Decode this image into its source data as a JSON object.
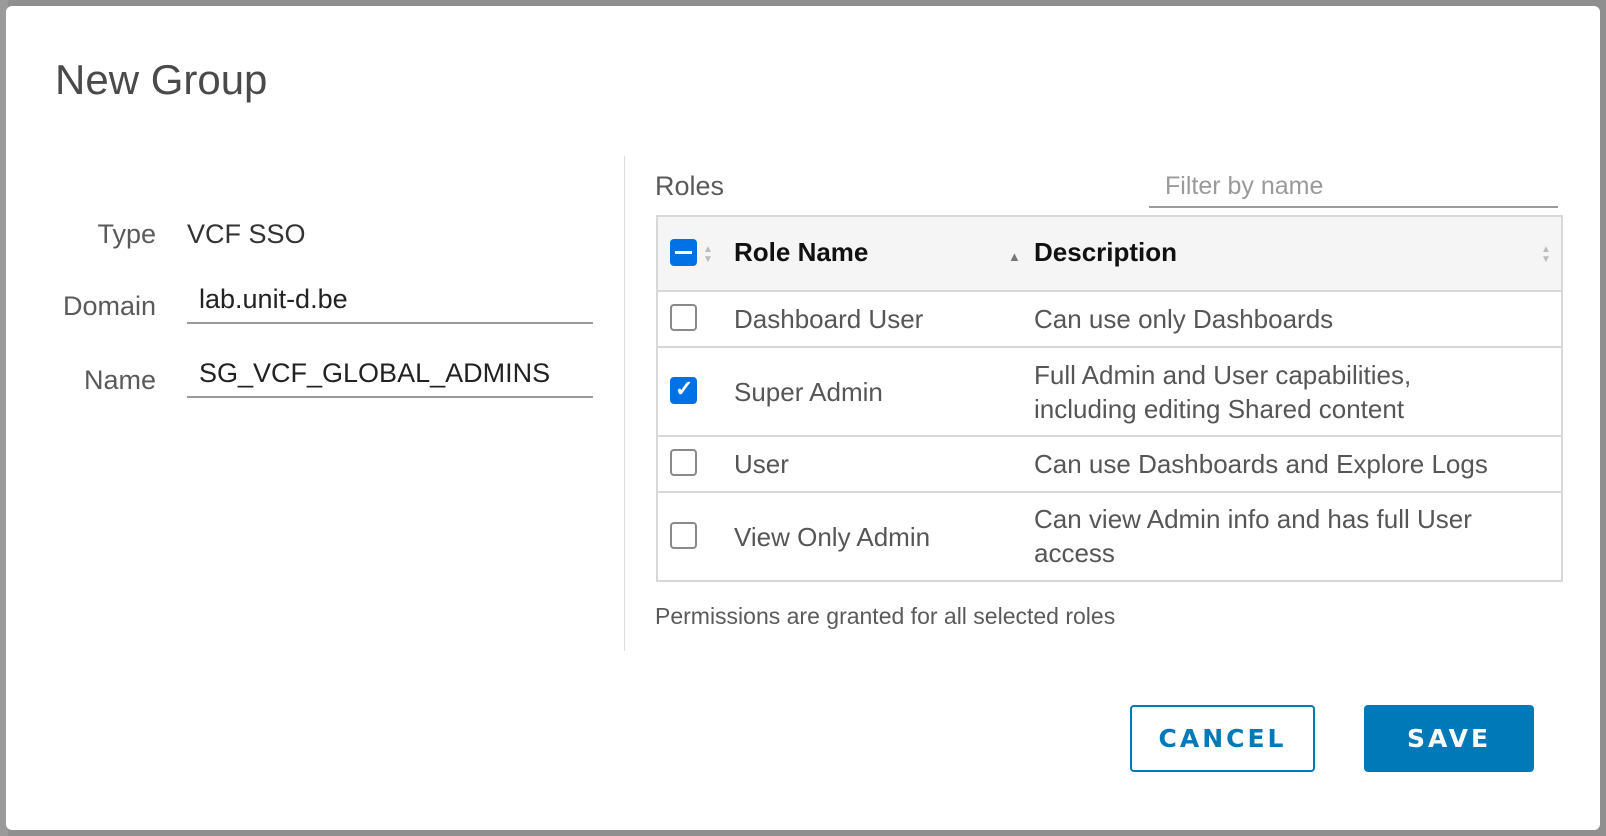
{
  "dialog": {
    "title": "New Group"
  },
  "form": {
    "type_label": "Type",
    "type_value": "VCF SSO",
    "domain_label": "Domain",
    "domain_value": "lab.unit-d.be",
    "name_label": "Name",
    "name_value": "SG_VCF_GLOBAL_ADMINS"
  },
  "roles": {
    "label": "Roles",
    "filter_placeholder": "Filter by name",
    "columns": [
      "Role Name",
      "Description"
    ],
    "select_all_state": "indeterminate",
    "rows": [
      {
        "name": "Dashboard User",
        "description": "Can use only Dashboards",
        "checked": false
      },
      {
        "name": "Super Admin",
        "description": "Full Admin and User capabilities, including editing Shared content",
        "checked": true
      },
      {
        "name": "User",
        "description": "Can use Dashboards and Explore Logs",
        "checked": false
      },
      {
        "name": "View Only Admin",
        "description": "Can view Admin info and has full User access",
        "checked": false
      }
    ],
    "note": "Permissions are granted for all selected roles"
  },
  "buttons": {
    "cancel": "CANCEL",
    "save": "SAVE"
  },
  "colors": {
    "primary": "#0079b8",
    "checkbox": "#0072e6"
  }
}
